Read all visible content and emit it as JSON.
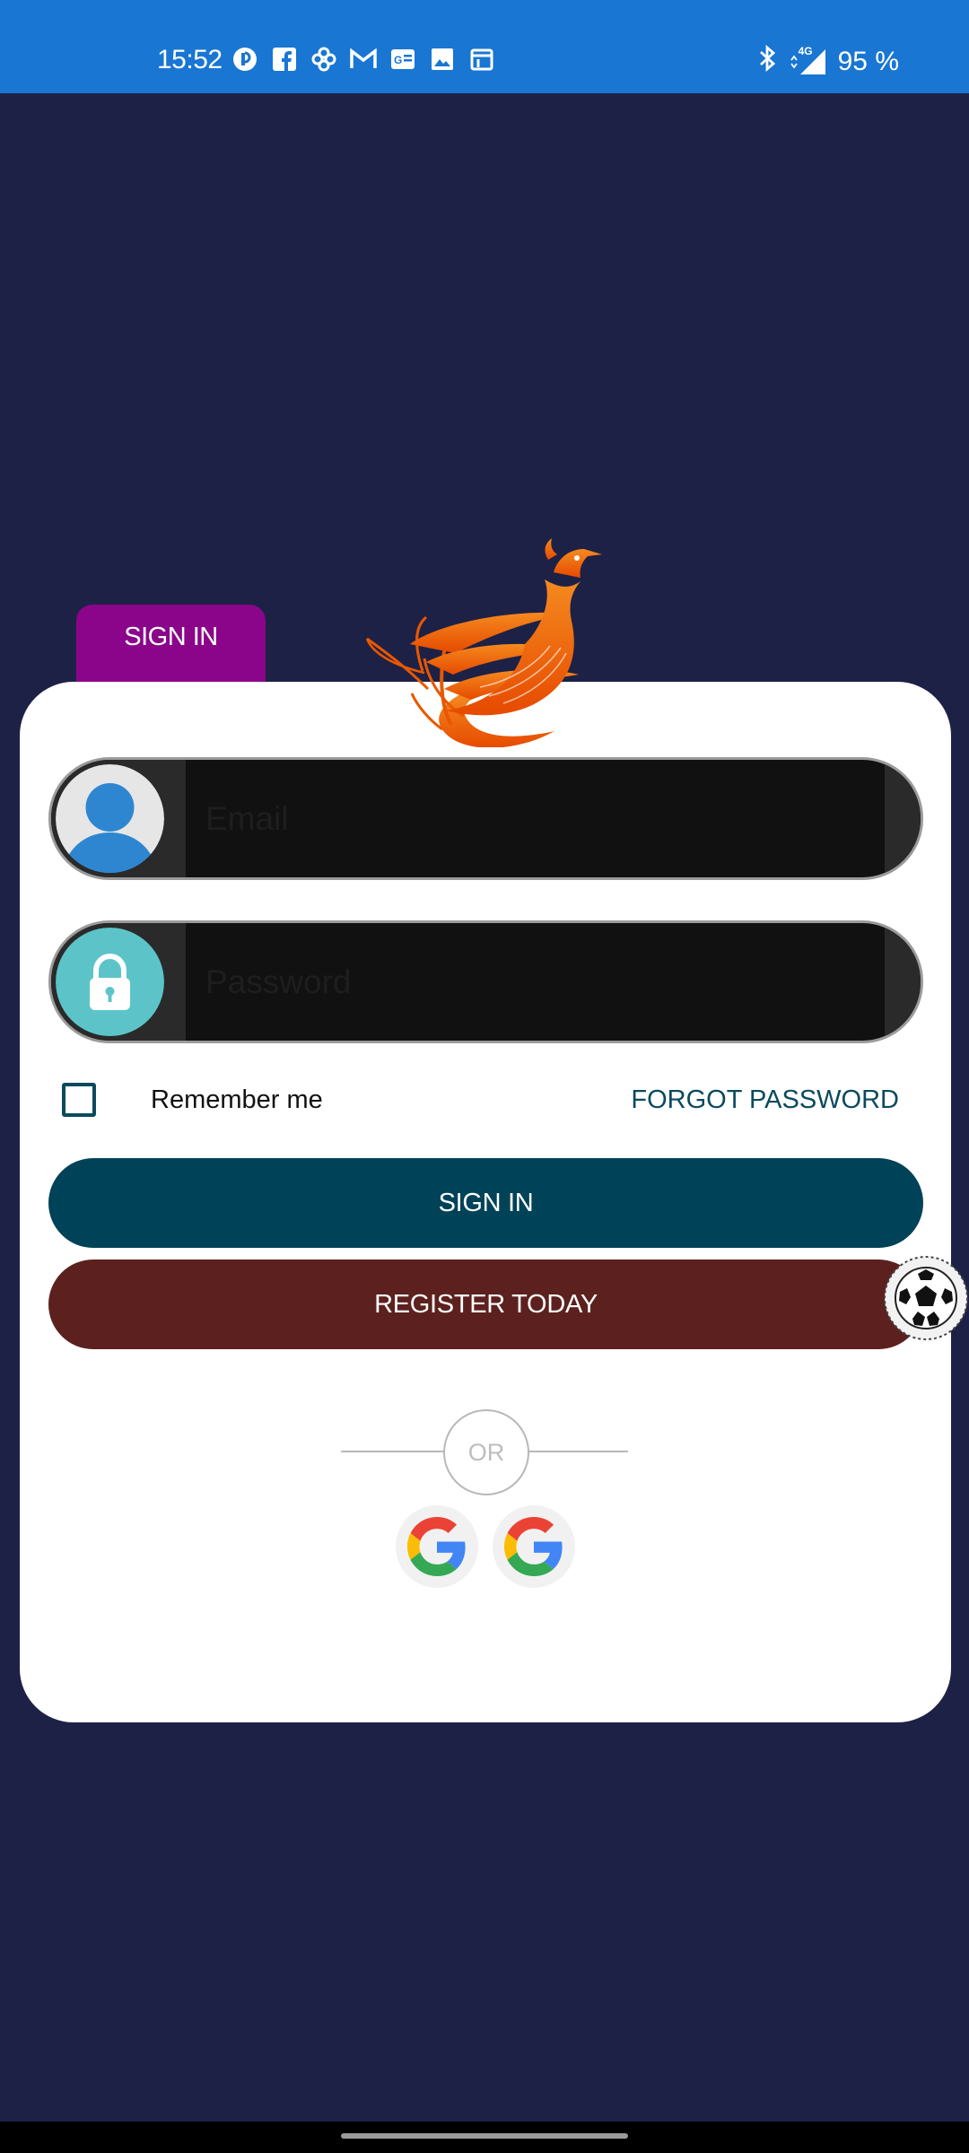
{
  "status_bar": {
    "time": "15:52",
    "left_icons": [
      "record-icon",
      "facebook-icon",
      "pinwheel-icon",
      "gmail-icon",
      "news-icon",
      "gallery-icon",
      "calendar-icon"
    ],
    "network_type": "4G",
    "battery": "95 %"
  },
  "tab": {
    "label": "SIGN IN"
  },
  "form": {
    "email_placeholder": "Email",
    "password_placeholder": "Password",
    "remember_label": "Remember me",
    "forgot_label": "FORGOT PASSWORD"
  },
  "buttons": {
    "signin_label": "SIGN IN",
    "register_label": "REGISTER TODAY"
  },
  "divider": {
    "or_label": "OR"
  },
  "social": {
    "providers": [
      "google",
      "google"
    ]
  },
  "colors": {
    "background": "#1e2146",
    "status_bar": "#1976d2",
    "tab": "#8b058b",
    "signin_button": "#004257",
    "register_button": "#5c211e",
    "forgot_link": "#0b4a5c"
  }
}
